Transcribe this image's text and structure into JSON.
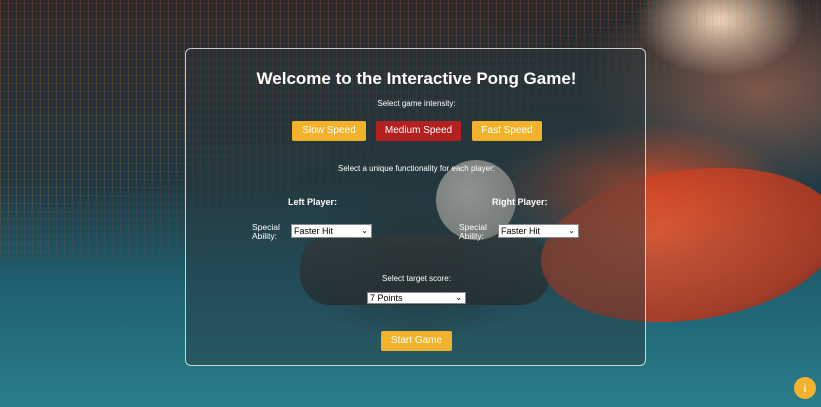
{
  "page": {
    "title": "Welcome to the Interactive Pong Game!",
    "intensity_prompt": "Select game intensity:",
    "speed_buttons": {
      "slow": "Slow Speed",
      "medium": "Medium Speed",
      "fast": "Fast Speed"
    },
    "functionality_prompt": "Select a unique functionality for each player:",
    "left_player": {
      "title": "Left Player:",
      "ability_label_line1": "Special",
      "ability_label_line2": "Ability:",
      "selected": "Faster Hit"
    },
    "right_player": {
      "title": "Right Player:",
      "ability_label_line1": "Special",
      "ability_label_line2": "Ability:",
      "selected": "Faster Hit"
    },
    "target_prompt": "Select target score:",
    "target_selected": "7 Points",
    "start_button": "Start Game",
    "info_button": "i",
    "chevron_glyph": "⌄"
  },
  "colors": {
    "accent_yellow": "#f2b22b",
    "active_red": "#b4201f",
    "text": "#ffffff"
  },
  "icons": {
    "info": "info-icon",
    "dropdown": "chevron-down-icon"
  }
}
